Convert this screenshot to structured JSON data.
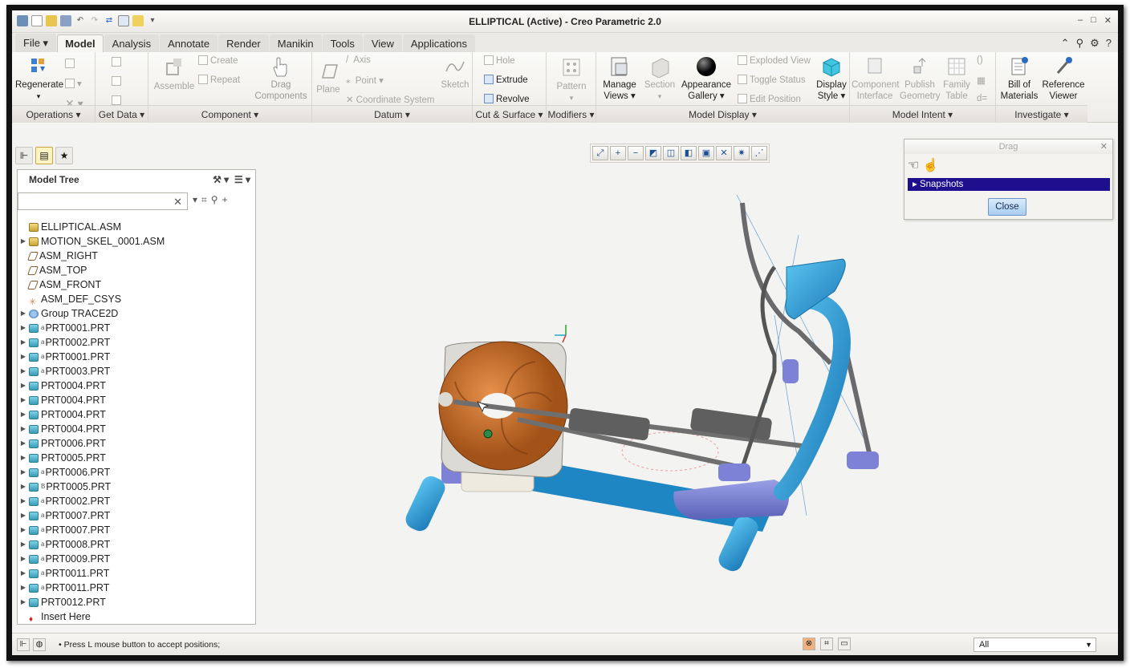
{
  "window": {
    "title": "ELLIPTICAL (Active) - Creo Parametric 2.0",
    "controls": [
      "–",
      "□",
      "✕"
    ]
  },
  "tabs": [
    {
      "label": "File ▾"
    },
    {
      "label": "Model",
      "active": true
    },
    {
      "label": "Analysis"
    },
    {
      "label": "Annotate"
    },
    {
      "label": "Render"
    },
    {
      "label": "Manikin"
    },
    {
      "label": "Tools"
    },
    {
      "label": "View"
    },
    {
      "label": "Applications"
    }
  ],
  "ribbon": {
    "groups": {
      "operations": "Operations ▾",
      "get_data": "Get Data ▾",
      "component": "Component ▾",
      "datum": "Datum ▾",
      "cut_surface": "Cut & Surface ▾",
      "modifiers": "Modifiers ▾",
      "model_display": "Model Display ▾",
      "model_intent": "Model Intent ▾",
      "investigate": "Investigate ▾"
    },
    "regenerate": "Regenerate",
    "assemble": "Assemble",
    "create": "Create",
    "repeat": "Repeat",
    "drag_components": "Drag Components",
    "plane": "Plane",
    "axis": "Axis",
    "point": "Point",
    "coordinate_system": "Coordinate System",
    "sketch": "Sketch",
    "hole": "Hole",
    "extrude": "Extrude",
    "revolve": "Revolve",
    "pattern": "Pattern",
    "manage_views": "Manage Views",
    "section": "Section",
    "appearance_gallery": "Appearance Gallery",
    "exploded_view": "Exploded View",
    "toggle_status": "Toggle Status",
    "edit_position": "Edit Position",
    "display_style": "Display Style",
    "component_interface": "Component Interface",
    "publish_geometry": "Publish Geometry",
    "family_table": "Family Table",
    "bill_of_materials": "Bill of Materials",
    "reference_viewer": "Reference Viewer"
  },
  "model_tree": {
    "header": "Model Tree",
    "search_placeholder": "",
    "items": [
      {
        "label": "ELLIPTICAL.ASM",
        "icon": "asm",
        "toggle": ""
      },
      {
        "label": "MOTION_SKEL_0001.ASM",
        "icon": "asm",
        "toggle": "▶"
      },
      {
        "label": "ASM_RIGHT",
        "icon": "plane",
        "toggle": ""
      },
      {
        "label": "ASM_TOP",
        "icon": "plane",
        "toggle": ""
      },
      {
        "label": "ASM_FRONT",
        "icon": "plane",
        "toggle": ""
      },
      {
        "label": "ASM_DEF_CSYS",
        "icon": "csys",
        "toggle": ""
      },
      {
        "label": "Group TRACE2D",
        "icon": "group",
        "toggle": "▶"
      },
      {
        "label": "PRT0001.PRT",
        "icon": "part",
        "toggle": "▶",
        "sup": "a"
      },
      {
        "label": "PRT0002.PRT",
        "icon": "part",
        "toggle": "▶",
        "sup": "a"
      },
      {
        "label": "PRT0001.PRT",
        "icon": "part",
        "toggle": "▶",
        "sup": "a"
      },
      {
        "label": "PRT0003.PRT",
        "icon": "part",
        "toggle": "▶",
        "sup": "a"
      },
      {
        "label": "PRT0004.PRT",
        "icon": "part",
        "toggle": "▶"
      },
      {
        "label": "PRT0004.PRT",
        "icon": "part",
        "toggle": "▶"
      },
      {
        "label": "PRT0004.PRT",
        "icon": "part",
        "toggle": "▶"
      },
      {
        "label": "PRT0004.PRT",
        "icon": "part",
        "toggle": "▶"
      },
      {
        "label": "PRT0006.PRT",
        "icon": "part",
        "toggle": "▶"
      },
      {
        "label": "PRT0005.PRT",
        "icon": "part",
        "toggle": "▶"
      },
      {
        "label": "PRT0006.PRT",
        "icon": "part",
        "toggle": "▶",
        "sup": "a"
      },
      {
        "label": "PRT0005.PRT",
        "icon": "part",
        "toggle": "▶",
        "sup": "B"
      },
      {
        "label": "PRT0002.PRT",
        "icon": "part",
        "toggle": "▶",
        "sup": "a"
      },
      {
        "label": "PRT0007.PRT",
        "icon": "part",
        "toggle": "▶",
        "sup": "a"
      },
      {
        "label": "PRT0007.PRT",
        "icon": "part",
        "toggle": "▶",
        "sup": "a"
      },
      {
        "label": "PRT0008.PRT",
        "icon": "part",
        "toggle": "▶",
        "sup": "a"
      },
      {
        "label": "PRT0009.PRT",
        "icon": "part",
        "toggle": "▶",
        "sup": "a"
      },
      {
        "label": "PRT0011.PRT",
        "icon": "part",
        "toggle": "▶",
        "sup": "a"
      },
      {
        "label": "PRT0011.PRT",
        "icon": "part",
        "toggle": "▶",
        "sup": "a"
      },
      {
        "label": "PRT0012.PRT",
        "icon": "part",
        "toggle": "▶"
      },
      {
        "label": "Insert Here",
        "icon": "insert",
        "toggle": ""
      }
    ]
  },
  "drag_dialog": {
    "title": "Drag",
    "snapshots": "Snapshots",
    "close": "Close"
  },
  "status": {
    "message": "• Press L mouse button to accept positions;",
    "filter": "All"
  }
}
